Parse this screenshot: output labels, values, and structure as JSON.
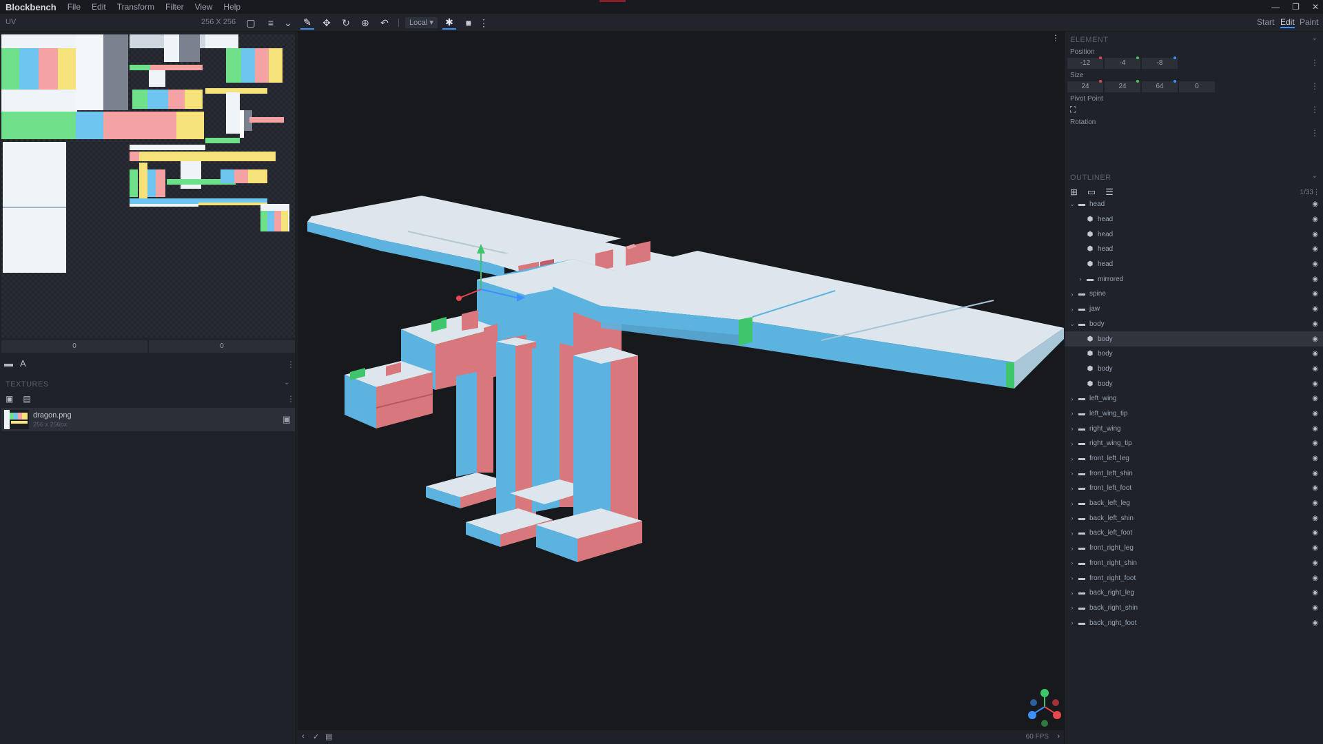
{
  "app": {
    "name": "Blockbench",
    "menu": [
      "File",
      "Edit",
      "Transform",
      "Filter",
      "View",
      "Help"
    ],
    "window_controls": [
      "—",
      "❐",
      "✕"
    ]
  },
  "toolbar": {
    "uv_label": "UV",
    "uv_size": "256 X 256",
    "transform_space": "Local ▾",
    "modes": [
      "Start",
      "Edit",
      "Paint"
    ],
    "active_mode": "Edit"
  },
  "uv_panel": {
    "inputs": [
      "0",
      "0"
    ]
  },
  "textures": {
    "title": "TEXTURES",
    "items": [
      {
        "name": "dragon.png",
        "size": "256 x 256px"
      }
    ]
  },
  "element": {
    "title": "ELEMENT",
    "position_label": "Position",
    "position": [
      "-12",
      "-4",
      "-8"
    ],
    "size_label": "Size",
    "size": [
      "24",
      "24",
      "64",
      "0"
    ],
    "pivot_label": "Pivot Point",
    "rotation_label": "Rotation",
    "axis_colors": {
      "x": "#e5484d",
      "y": "#4bc45a",
      "z": "#3e90ff"
    }
  },
  "outliner": {
    "title": "OUTLINER",
    "count": "1/33",
    "items": [
      {
        "label": "head",
        "type": "group",
        "depth": 0,
        "expanded": true
      },
      {
        "label": "head",
        "type": "cube",
        "depth": 1
      },
      {
        "label": "head",
        "type": "cube",
        "depth": 1
      },
      {
        "label": "head",
        "type": "cube",
        "depth": 1
      },
      {
        "label": "head",
        "type": "cube",
        "depth": 1
      },
      {
        "label": "mirrored",
        "type": "group",
        "depth": 1,
        "expanded": false
      },
      {
        "label": "spine",
        "type": "group",
        "depth": 0,
        "expanded": false
      },
      {
        "label": "jaw",
        "type": "group",
        "depth": 0,
        "expanded": false
      },
      {
        "label": "body",
        "type": "group",
        "depth": 0,
        "expanded": true
      },
      {
        "label": "body",
        "type": "cube",
        "depth": 1,
        "selected": true
      },
      {
        "label": "body",
        "type": "cube",
        "depth": 1
      },
      {
        "label": "body",
        "type": "cube",
        "depth": 1
      },
      {
        "label": "body",
        "type": "cube",
        "depth": 1
      },
      {
        "label": "left_wing",
        "type": "group",
        "depth": 0,
        "expanded": false
      },
      {
        "label": "left_wing_tip",
        "type": "group",
        "depth": 0,
        "expanded": false
      },
      {
        "label": "right_wing",
        "type": "group",
        "depth": 0,
        "expanded": false
      },
      {
        "label": "right_wing_tip",
        "type": "group",
        "depth": 0,
        "expanded": false
      },
      {
        "label": "front_left_leg",
        "type": "group",
        "depth": 0,
        "expanded": false
      },
      {
        "label": "front_left_shin",
        "type": "group",
        "depth": 0,
        "expanded": false
      },
      {
        "label": "front_left_foot",
        "type": "group",
        "depth": 0,
        "expanded": false
      },
      {
        "label": "back_left_leg",
        "type": "group",
        "depth": 0,
        "expanded": false
      },
      {
        "label": "back_left_shin",
        "type": "group",
        "depth": 0,
        "expanded": false
      },
      {
        "label": "back_left_foot",
        "type": "group",
        "depth": 0,
        "expanded": false
      },
      {
        "label": "front_right_leg",
        "type": "group",
        "depth": 0,
        "expanded": false
      },
      {
        "label": "front_right_shin",
        "type": "group",
        "depth": 0,
        "expanded": false
      },
      {
        "label": "front_right_foot",
        "type": "group",
        "depth": 0,
        "expanded": false
      },
      {
        "label": "back_right_leg",
        "type": "group",
        "depth": 0,
        "expanded": false
      },
      {
        "label": "back_right_shin",
        "type": "group",
        "depth": 0,
        "expanded": false
      },
      {
        "label": "back_right_foot",
        "type": "group",
        "depth": 0,
        "expanded": false
      }
    ]
  },
  "viewport": {
    "fps": "60 FPS",
    "model_colors": {
      "top": "#dce6ec",
      "side_blue": "#5cb3e0",
      "side_red": "#d9787c",
      "accent_green": "#3fc66a"
    }
  }
}
